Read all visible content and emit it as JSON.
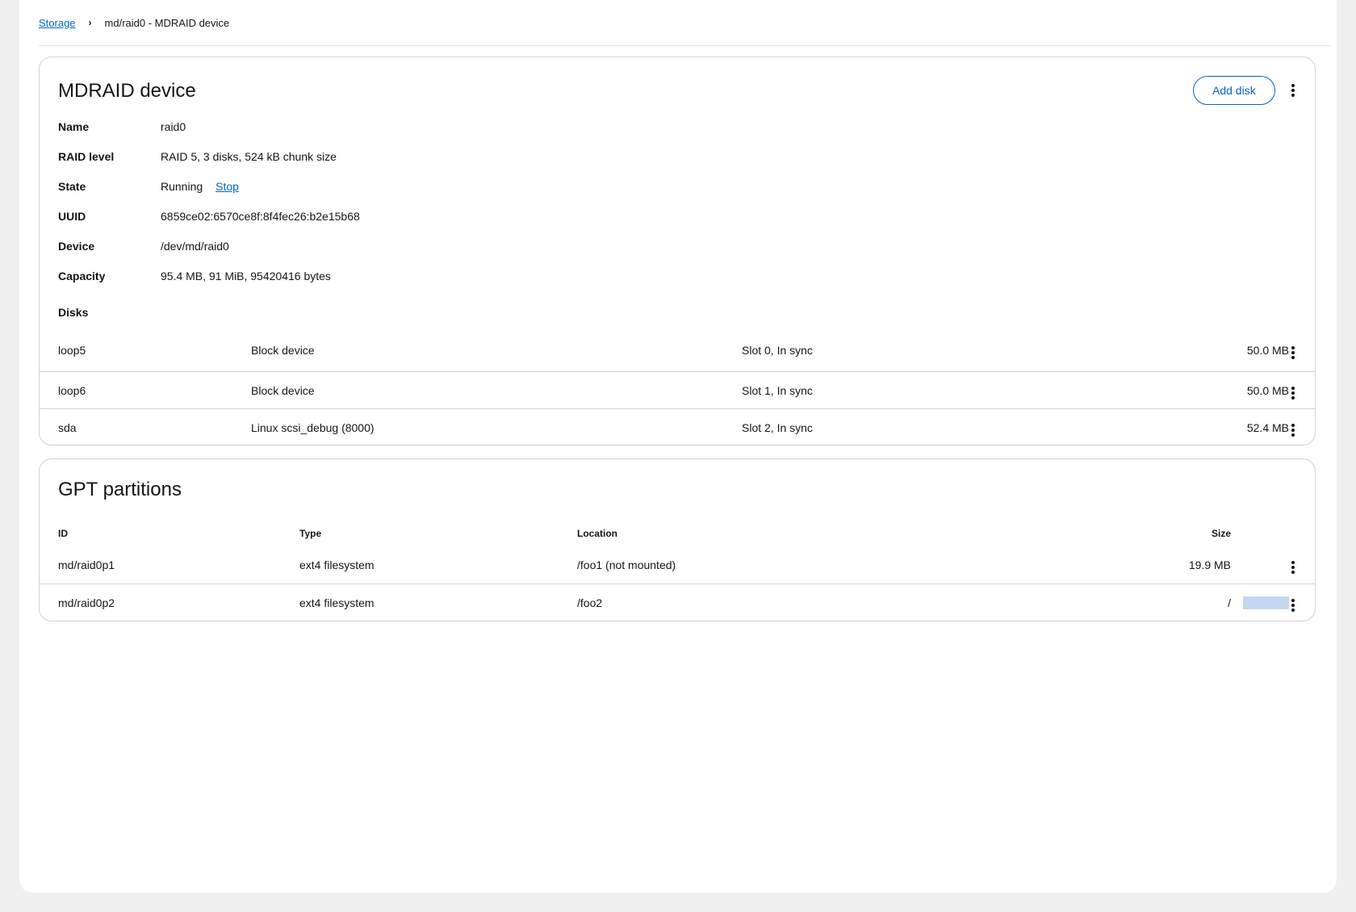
{
  "breadcrumb": {
    "root": "Storage",
    "current": "md/raid0 - MDRAID device"
  },
  "mdraid": {
    "title": "MDRAID device",
    "add_disk_label": "Add disk",
    "fields": [
      {
        "term": "Name",
        "value": "raid0"
      },
      {
        "term": "RAID level",
        "value": "RAID 5, 3 disks, 524 kB chunk size"
      },
      {
        "term": "State",
        "value": "Running",
        "action": "Stop"
      },
      {
        "term": "UUID",
        "value": "6859ce02:6570ce8f:8f4fec26:b2e15b68"
      },
      {
        "term": "Device",
        "value": "/dev/md/raid0"
      },
      {
        "term": "Capacity",
        "value": "95.4 MB, 91 MiB, 95420416 bytes"
      }
    ],
    "disks_label": "Disks",
    "disks": [
      {
        "name": "loop5",
        "type": "Block device",
        "slot": "Slot 0, In sync",
        "size": "50.0 MB"
      },
      {
        "name": "loop6",
        "type": "Block device",
        "slot": "Slot 1, In sync",
        "size": "50.0 MB"
      },
      {
        "name": "sda",
        "type": "Linux scsi_debug (8000)",
        "slot": "Slot 2, In sync",
        "size": "52.4 MB"
      }
    ]
  },
  "gpt": {
    "title": "GPT partitions",
    "columns": {
      "id": "ID",
      "type": "Type",
      "location": "Location",
      "size": "Size"
    },
    "rows": [
      {
        "id": "md/raid0p1",
        "type": "ext4 filesystem",
        "location": "/foo1 (not mounted)",
        "size": "19.9 MB"
      },
      {
        "id": "md/raid0p2",
        "type": "ext4 filesystem",
        "location": "/foo2",
        "size": "/"
      }
    ]
  },
  "colors": {
    "link": "#0066cc",
    "border": "#d2d2d2",
    "page_bg": "#f0f0f0"
  }
}
